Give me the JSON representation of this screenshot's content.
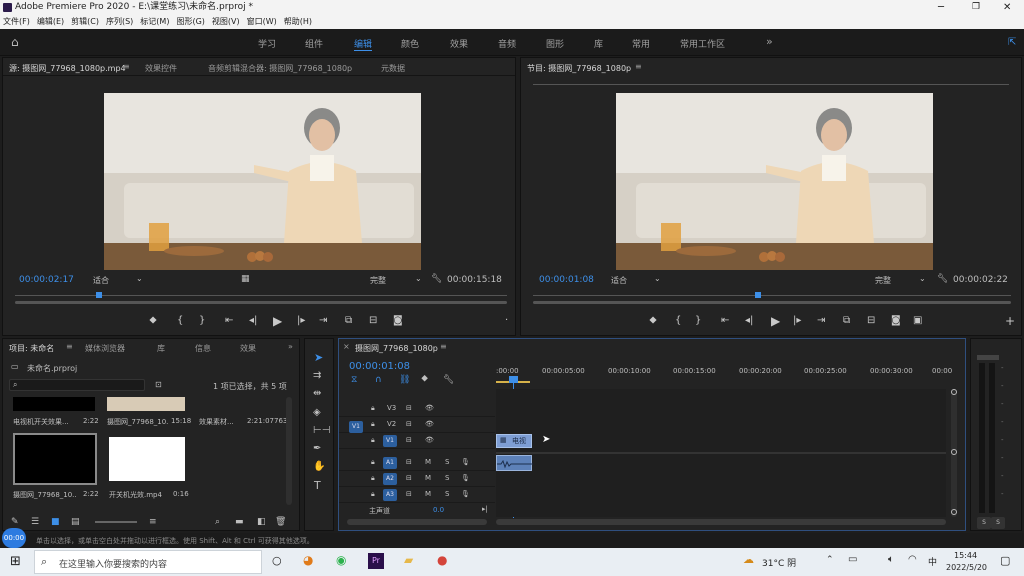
{
  "window": {
    "title": "Adobe Premiere Pro 2020 - E:\\课堂练习\\未命名.prproj *"
  },
  "menu": [
    "文件(F)",
    "编辑(E)",
    "剪辑(C)",
    "序列(S)",
    "标记(M)",
    "图形(G)",
    "视图(V)",
    "窗口(W)",
    "帮助(H)"
  ],
  "workspaces": [
    "学习",
    "组件",
    "编辑",
    "颜色",
    "效果",
    "音频",
    "图形",
    "库",
    "常用",
    "常用工作区"
  ],
  "workspace_active": "编辑",
  "source": {
    "tabs": [
      "源: 摄图网_77968_1080p.mp4",
      "效果控件",
      "音频剪辑混合器: 摄图网_77968_1080p",
      "元数据"
    ],
    "timecode": "00:00:02:17",
    "fit": "适合",
    "quality": "完整",
    "duration": "00:00:15:18",
    "playhead": 0.17
  },
  "program": {
    "tab": "节目: 摄图网_77968_1080p",
    "timecode": "00:00:01:08",
    "fit": "适合",
    "quality": "完整",
    "duration": "00:00:02:22",
    "playhead": 0.47
  },
  "project": {
    "tabs": [
      "项目: 未命名",
      "媒体浏览器",
      "库",
      "信息",
      "效果"
    ],
    "file": "未命名.prproj",
    "selection": "1 项已选择，共 5 项",
    "items": [
      {
        "name": "电视机开关效果...",
        "dur": "2:22"
      },
      {
        "name": "摄图网_77968_10...",
        "dur": "15:18"
      },
      {
        "name": "效果素材...",
        "dur": "2:21:07763"
      },
      {
        "name": "摄图网_77968_10...",
        "dur": "2:22"
      },
      {
        "name": "开关机光效.mp4",
        "dur": "0:16"
      }
    ]
  },
  "timeline": {
    "tab": "摄图网_77968_1080p",
    "timecode": "00:00:01:08",
    "ruler": [
      ":00:00",
      "00:00:05:00",
      "00:00:10:00",
      "00:00:15:00",
      "00:00:20:00",
      "00:00:25:00",
      "00:00:30:00",
      "00:00"
    ],
    "video_tracks": [
      "V3",
      "V2",
      "V1"
    ],
    "audio_tracks": [
      "A1",
      "A2",
      "A3"
    ],
    "source_patch_v": "V1",
    "master": {
      "label": "主声道",
      "value": "0.0"
    },
    "clip_label": "电视",
    "track_buttons": {
      "m": "M",
      "s": "S"
    }
  },
  "audio_meter": {
    "solo": [
      "S",
      "S"
    ]
  },
  "status_bar": "单击以选择，或单击空白处并拖动以进行框选。使用 Shift、Alt 和 Ctrl 可获得其他选项。",
  "playback_badge": "00:00",
  "taskbar": {
    "search_placeholder": "在这里输入你要搜索的内容",
    "weather": "31°C 阴",
    "ime": "中",
    "time": "15:44",
    "date": "2022/5/20"
  }
}
